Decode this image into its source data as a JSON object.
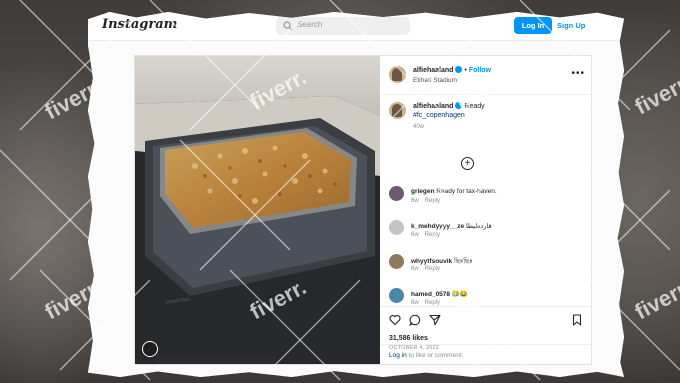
{
  "header": {
    "logo": "Instagram",
    "search_placeholder": "Search",
    "login_label": "Log In",
    "signup_label": "Sign Up"
  },
  "post": {
    "author": {
      "username": "alfiehaaland",
      "follow_label": "Follow",
      "location": "Etihad Stadium"
    },
    "caption": {
      "username": "alfiehaaland",
      "text": "Ready",
      "hashtag": "#fc_copenhagen",
      "age": "40w"
    },
    "comments": [
      {
        "username": "griegen",
        "text": "Ready for tax-haven.",
        "age": "6w",
        "reply": "Reply",
        "avatar_color": "#6d5a72"
      },
      {
        "username": "k_mehdyyyy__ze",
        "text": "قاردطيطا",
        "age": "6w",
        "reply": "Reply",
        "avatar_color": "#c4c4c4"
      },
      {
        "username": "whyytfsouvik",
        "text": "ছিঃছিঃ",
        "age": "6w",
        "reply": "Reply",
        "avatar_color": "#8d7b5c"
      },
      {
        "username": "hamed_0578",
        "text": "😂😂",
        "age": "6w",
        "reply": "Reply",
        "avatar_color": "#4a86a8"
      }
    ],
    "likes": "31,586 likes",
    "date": "OCTOBER 4, 2022",
    "login_prompt_link": "Log in",
    "login_prompt_text": "to like or comment."
  },
  "watermark": "fiverr.",
  "icons": {
    "search": "search-icon",
    "more": "more-options-icon",
    "add": "add-comment-icon",
    "like": "heart-icon",
    "comment": "comment-icon",
    "share": "share-icon",
    "save": "bookmark-icon",
    "tag": "user-tag-icon"
  },
  "colors": {
    "brand_blue": "#0095f6",
    "link_dark": "#00376b"
  }
}
